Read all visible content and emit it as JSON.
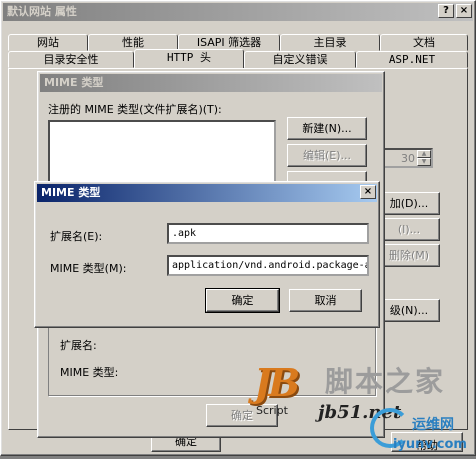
{
  "properties_window": {
    "title": "默认网站 属性",
    "tabs_back": [
      "网站",
      "性能",
      "ISAPI 筛选器",
      "主目录",
      "文档"
    ],
    "tabs_front": [
      "目录安全性",
      "HTTP 头",
      "自定义错误",
      "ASP.NET"
    ],
    "help_label": "?",
    "close_label": "×",
    "spin_value": "30",
    "right_buttons": [
      "加(D)...",
      "(I)...",
      "删除(M)",
      "级(N)..."
    ],
    "bottom_buttons": [
      "确定",
      "帮助"
    ]
  },
  "mime_types_dialog": {
    "title": "MIME 类型",
    "registered_label": "注册的 MIME 类型(文件扩展名)(T):",
    "new_button": "新建(N)...",
    "edit_button": "编辑(E)...",
    "details": {
      "extension_label": "扩展名:",
      "mime_label": "MIME 类型:"
    },
    "ok_button": "确定"
  },
  "mime_type_dialog": {
    "title": "MIME 类型",
    "close_label": "×",
    "extension_label": "扩展名(E):",
    "extension_value": ".apk",
    "mime_label": "MIME 类型(M):",
    "mime_value": "application/vnd.android.package-a",
    "ok_button": "确定",
    "cancel_button": "取消"
  },
  "watermark": {
    "logo": "JB",
    "logo_sub": "Script",
    "site_cn": "脚本之家",
    "site_url": "jb51.net",
    "corner_cn": "运维网",
    "corner_url": "iyunv.com"
  }
}
